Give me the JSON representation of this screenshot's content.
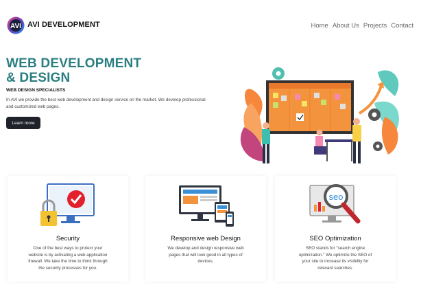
{
  "header": {
    "brand": "AVI DEVELOPMENT",
    "nav": [
      "Home",
      "About Us",
      "Projects",
      "Contact"
    ]
  },
  "hero": {
    "title_line1": "WEB DEVELOPMENT",
    "title_line2": "& DESIGN",
    "subtitle": "WEB DESIGN SPECIALISTS",
    "description": "In AVI we provide the best web development and design service on the market. We develop professional and customized web pages.",
    "button_label": "Learn more"
  },
  "services": [
    {
      "title": "Security",
      "text": "One of the best ways to protect your website is by activating a web application firewall. We take the time to think through the security processes for you.",
      "icon": "security-icon"
    },
    {
      "title": "Responsive web Design",
      "text": "We develop and design responsive web pages that will look good in all types of devices.",
      "icon": "responsive-icon"
    },
    {
      "title": "SEO Optimization",
      "text": "SEO stands for \"search engine optimization.\" We optimize the SEO of your site to increase its visibility for relevant searches.",
      "icon": "seo-icon",
      "icon_text": "seo"
    }
  ],
  "illustration": {
    "board_columns": [
      "",
      "",
      "",
      ""
    ]
  },
  "colors": {
    "title": "#2a7e80",
    "button": "#1f2329",
    "check": "#e3212d"
  }
}
